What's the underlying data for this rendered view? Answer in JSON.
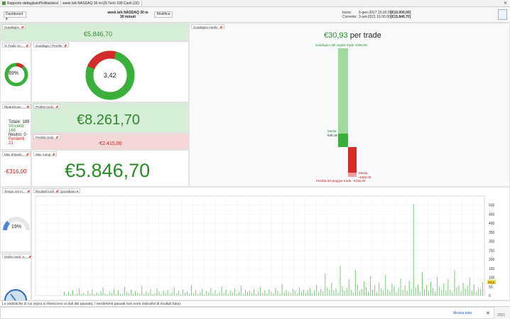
{
  "tabs": [
    {
      "label": "Rapporto dettagliato"
    },
    {
      "label": "ProBacktest"
    },
    {
      "label": "week brk NASDAQ 30 m"
    },
    {
      "label": "US Tech 100 Cash (1€)"
    }
  ],
  "header": {
    "dashboard_label": "Dashboard",
    "strategy_name": "week brk NASDAQ 30 m",
    "timeframe": "30 minuti",
    "modify_label": "Modifica",
    "start_label": "Inizio:",
    "start_date": "6-gen-2017 15.00.00",
    "start_capital": "[€10.000,00]",
    "current_label": "Corrente:",
    "current_date": "3-set-2021 16.00.00",
    "current_capital": "[€15.846,70]"
  },
  "panels": {
    "gain_title": "Guadagno",
    "gain_value": "€5.846,70",
    "avg_gain_title": "Guadagno medio",
    "avg_gain_value": "€30,93",
    "avg_gain_suffix": "per trade",
    "best_trade_label": "Guadagno del miglior trade: €356,90",
    "mean_label_up": "Media",
    "mean_value_up": "€45,18",
    "mean_label_down": "Media",
    "mean_value_down": "-€115,00",
    "worst_trade_label": "Perdita del peggior trade: -€115,00",
    "winrate_title": "% Trade vin...",
    "winrate_value": "89%",
    "gl_title": "Guadagni / Perdite",
    "gl_value": "3,42",
    "breakdown_title": "Ripartizione ...",
    "total_label": "Totale:",
    "total_value": "189",
    "winners_label": "Vincenti:",
    "winners_value": "168",
    "neutral_label": "Neutro:",
    "neutral_value": "0",
    "losers_label": "Perdenti:",
    "losers_value": "21",
    "gross_profit_title": "Profitto lordo",
    "gross_profit_value": "€8.261,70",
    "gross_loss_title": "Perdita lorda",
    "gross_loss_value": "-€2.415,00",
    "max_dd_title": "Max drawdo...",
    "max_dd_value": "-€316,00",
    "max_runup_title": "Max runup",
    "max_runup_value": "€5.846,70",
    "time_title": "Tempo nel m...",
    "time_value": "19%",
    "orders_title": "Ordini medi. e...",
    "results_title": "Risultati lordi",
    "period_select": "Quotidiano"
  },
  "chart_data": {
    "type": "bar",
    "title": "",
    "yticks": [
      0,
      50,
      100,
      150,
      200,
      250,
      300,
      350,
      400,
      450,
      500
    ],
    "ylim": [
      0,
      550
    ],
    "marker_value": "74,3",
    "values": [
      18,
      5,
      22,
      8,
      31,
      4,
      12,
      40,
      9,
      16,
      6,
      28,
      11,
      35,
      7,
      19,
      13,
      25,
      44,
      10,
      8,
      22,
      15,
      38,
      6,
      29,
      12,
      9,
      47,
      20,
      14,
      33,
      7,
      26,
      18,
      11,
      52,
      9,
      24,
      17,
      36,
      8,
      13,
      41,
      21,
      6,
      28,
      15,
      31,
      10,
      19,
      45,
      12,
      27,
      8,
      34,
      16,
      23,
      9,
      57,
      14,
      30,
      11,
      20,
      38,
      7,
      25,
      18,
      43,
      13,
      29,
      10,
      22,
      50,
      15,
      33,
      9,
      26,
      17,
      40,
      12,
      21,
      55,
      8,
      31,
      19,
      27,
      14,
      36,
      10,
      24,
      48,
      16,
      29,
      11,
      35,
      20,
      13,
      42,
      26,
      9,
      64,
      18,
      31,
      22,
      15,
      38,
      27,
      12,
      46,
      21,
      33,
      17,
      29,
      40,
      14,
      25,
      58,
      19,
      36,
      23,
      120,
      45,
      31,
      70,
      28,
      39,
      15,
      165,
      52,
      26,
      44,
      90,
      33,
      18,
      140,
      61,
      25,
      37,
      80,
      48,
      22,
      110,
      34,
      58,
      20,
      72,
      41,
      29,
      115,
      36,
      24,
      66,
      50,
      19,
      43,
      95,
      30,
      55,
      27,
      82,
      38,
      505,
      46,
      61,
      22,
      130,
      35,
      57,
      25,
      76,
      40,
      21,
      105,
      49,
      31,
      68,
      27,
      88,
      33,
      19,
      142,
      45,
      56,
      24,
      71,
      37,
      52,
      98,
      29,
      64,
      21,
      45,
      36,
      74
    ]
  }
}
